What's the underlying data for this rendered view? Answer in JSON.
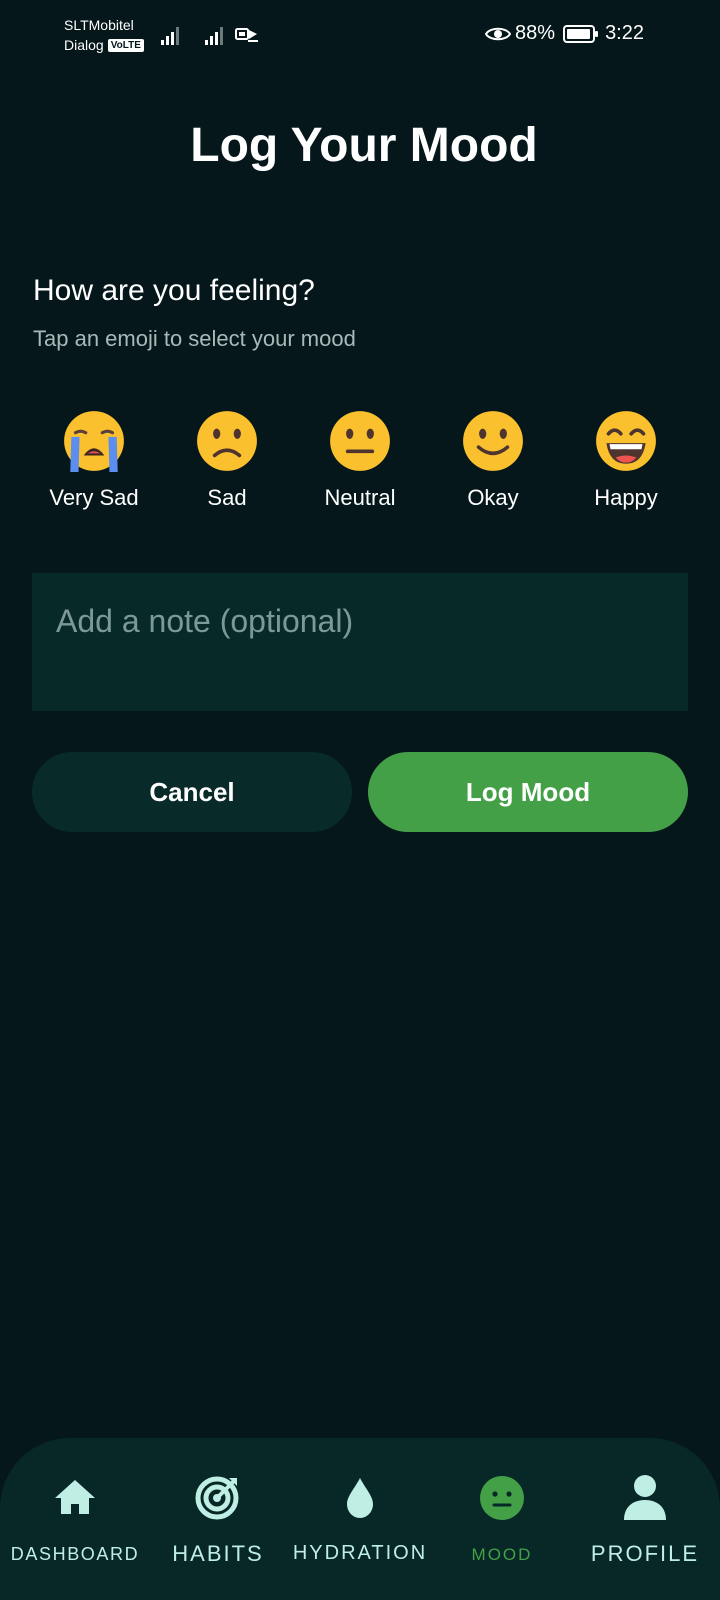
{
  "status_bar": {
    "carrier_1": "SLTMobitel",
    "carrier_2": "Dialog",
    "volte_badge": "VoLTE",
    "battery_percent": "88%",
    "time": "3:22",
    "icons": [
      "signal-icon",
      "signal-icon",
      "data-saver-icon",
      "eye-icon",
      "battery-icon"
    ]
  },
  "page": {
    "title": "Log Your Mood"
  },
  "prompt": {
    "title": "How are you feeling?",
    "subtitle": "Tap an emoji to select your mood"
  },
  "moods": [
    {
      "label": "Very Sad",
      "icon": "loudly-crying-face-icon"
    },
    {
      "label": "Sad",
      "icon": "slightly-frowning-face-icon"
    },
    {
      "label": "Neutral",
      "icon": "neutral-face-icon"
    },
    {
      "label": "Okay",
      "icon": "slightly-smiling-face-icon"
    },
    {
      "label": "Happy",
      "icon": "grinning-face-icon"
    }
  ],
  "note": {
    "placeholder": "Add a note (optional)",
    "value": ""
  },
  "actions": {
    "cancel_label": "Cancel",
    "log_label": "Log Mood"
  },
  "bottom_nav": {
    "active": "MOOD",
    "items": [
      {
        "label": "DASHBOARD",
        "icon": "home-icon"
      },
      {
        "label": "HABITS",
        "icon": "target-icon"
      },
      {
        "label": "HYDRATION",
        "icon": "water-drop-icon"
      },
      {
        "label": "MOOD",
        "icon": "mood-face-icon"
      },
      {
        "label": "PROFILE",
        "icon": "person-icon"
      }
    ]
  },
  "colors": {
    "background": "#05171a",
    "surface": "#072a29",
    "accent_green": "#43a047",
    "nav_text": "#bfeee4",
    "subtext": "#a9b9b8"
  }
}
